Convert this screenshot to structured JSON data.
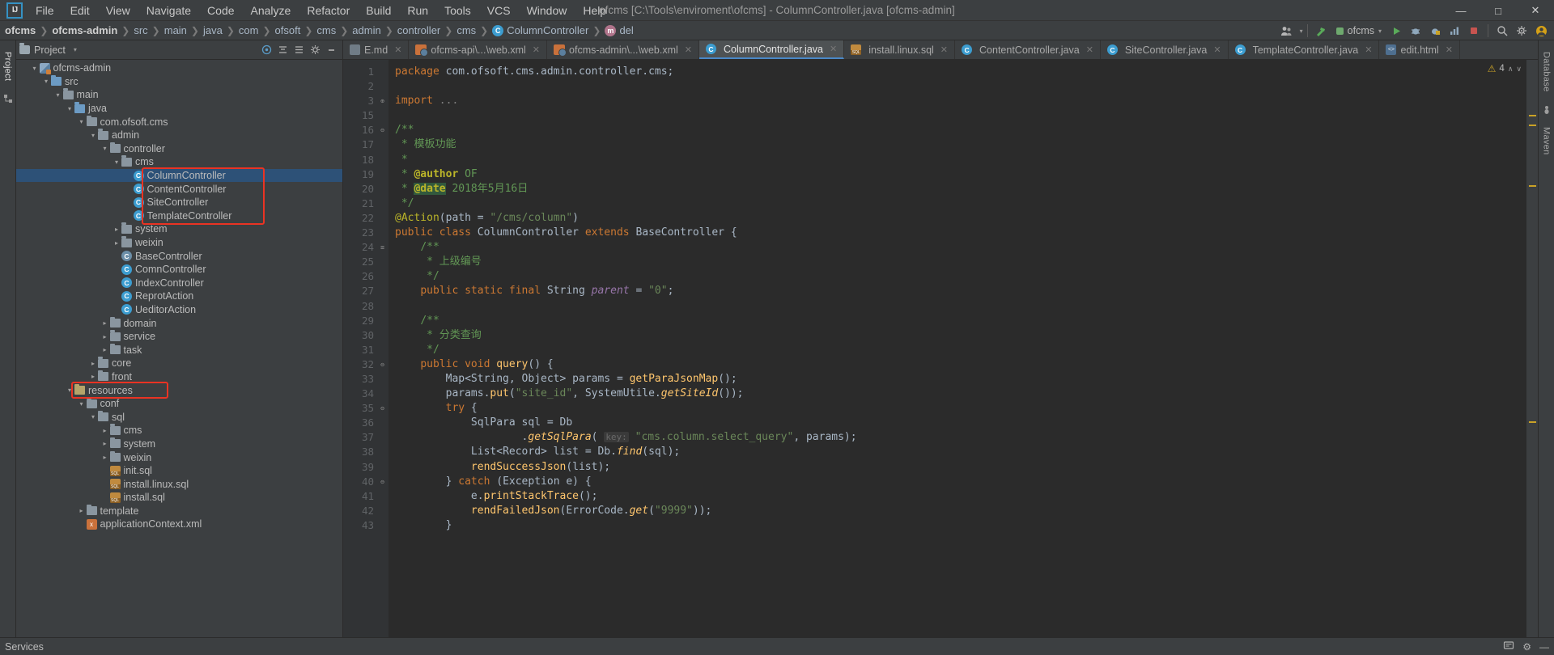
{
  "window": {
    "title": "ofcms [C:\\Tools\\enviroment\\ofcms] - ColumnController.java [ofcms-admin]",
    "logo": "IJ",
    "minimize": "—",
    "maximize": "□",
    "close": "✕"
  },
  "menu": [
    {
      "label": "File"
    },
    {
      "label": "Edit"
    },
    {
      "label": "View"
    },
    {
      "label": "Navigate"
    },
    {
      "label": "Code"
    },
    {
      "label": "Analyze"
    },
    {
      "label": "Refactor"
    },
    {
      "label": "Build"
    },
    {
      "label": "Run"
    },
    {
      "label": "Tools"
    },
    {
      "label": "VCS"
    },
    {
      "label": "Window"
    },
    {
      "label": "Help"
    }
  ],
  "breadcrumb": [
    {
      "label": "ofcms",
      "bold": true
    },
    {
      "label": "ofcms-admin",
      "bold": true
    },
    {
      "label": "src"
    },
    {
      "label": "main"
    },
    {
      "label": "java"
    },
    {
      "label": "com"
    },
    {
      "label": "ofsoft"
    },
    {
      "label": "cms"
    },
    {
      "label": "admin"
    },
    {
      "label": "controller"
    },
    {
      "label": "cms"
    },
    {
      "label": "ColumnController",
      "badge": "C"
    },
    {
      "label": "del",
      "badge": "m"
    }
  ],
  "navbar_right": {
    "run_config": "ofcms",
    "user_icon": "user-icon",
    "build_icon": "hammer-icon",
    "run_icon": "▶",
    "debug_icon": "debug-icon",
    "coverage_icon": "coverage-icon",
    "profile_icon": "profile-icon",
    "stop_icon": "■",
    "search_icon": "⚲",
    "settings_icon": "⚙",
    "avatar_icon": "avatar-icon"
  },
  "left_strip": {
    "project_tab": "Project",
    "structure_icon": "structure-icon"
  },
  "right_strip": {
    "database_tab": "Database",
    "maven_tab": "Maven",
    "ant_icon": "ant-icon"
  },
  "project_panel": {
    "title": "Project",
    "caret": "▾",
    "buttons": [
      "target-icon",
      "collapse-icon",
      "expand-icon",
      "gear-icon",
      "minimize-icon"
    ]
  },
  "tree": [
    {
      "indent": 1,
      "arrow": "▾",
      "icon": "module",
      "label": "ofcms-admin"
    },
    {
      "indent": 2,
      "arrow": "▾",
      "icon": "src",
      "label": "src"
    },
    {
      "indent": 3,
      "arrow": "▾",
      "icon": "folder",
      "label": "main"
    },
    {
      "indent": 4,
      "arrow": "▾",
      "icon": "src",
      "label": "java"
    },
    {
      "indent": 5,
      "arrow": "▾",
      "icon": "folder",
      "label": "com.ofsoft.cms"
    },
    {
      "indent": 6,
      "arrow": "▾",
      "icon": "folder",
      "label": "admin"
    },
    {
      "indent": 7,
      "arrow": "▾",
      "icon": "folder",
      "label": "controller"
    },
    {
      "indent": 8,
      "arrow": "▾",
      "icon": "folder",
      "label": "cms"
    },
    {
      "indent": 9,
      "arrow": "",
      "icon": "class",
      "label": "ColumnController",
      "selected": true
    },
    {
      "indent": 9,
      "arrow": "",
      "icon": "class",
      "label": "ContentController"
    },
    {
      "indent": 9,
      "arrow": "",
      "icon": "class",
      "label": "SiteController"
    },
    {
      "indent": 9,
      "arrow": "",
      "icon": "class",
      "label": "TemplateController"
    },
    {
      "indent": 8,
      "arrow": "▸",
      "icon": "folder",
      "label": "system"
    },
    {
      "indent": 8,
      "arrow": "▸",
      "icon": "folder",
      "label": "weixin"
    },
    {
      "indent": 8,
      "arrow": "",
      "icon": "class-abstract",
      "label": "BaseController"
    },
    {
      "indent": 8,
      "arrow": "",
      "icon": "class",
      "label": "ComnController"
    },
    {
      "indent": 8,
      "arrow": "",
      "icon": "class",
      "label": "IndexController"
    },
    {
      "indent": 8,
      "arrow": "",
      "icon": "class",
      "label": "ReprotAction"
    },
    {
      "indent": 8,
      "arrow": "",
      "icon": "class",
      "label": "UeditorAction"
    },
    {
      "indent": 7,
      "arrow": "▸",
      "icon": "folder",
      "label": "domain"
    },
    {
      "indent": 7,
      "arrow": "▸",
      "icon": "folder",
      "label": "service"
    },
    {
      "indent": 7,
      "arrow": "▸",
      "icon": "folder",
      "label": "task"
    },
    {
      "indent": 6,
      "arrow": "▸",
      "icon": "folder",
      "label": "core"
    },
    {
      "indent": 6,
      "arrow": "▸",
      "icon": "folder",
      "label": "front"
    },
    {
      "indent": 4,
      "arrow": "▾",
      "icon": "res",
      "label": "resources"
    },
    {
      "indent": 5,
      "arrow": "▾",
      "icon": "folder",
      "label": "conf"
    },
    {
      "indent": 6,
      "arrow": "▾",
      "icon": "folder",
      "label": "sql"
    },
    {
      "indent": 7,
      "arrow": "▸",
      "icon": "folder",
      "label": "cms"
    },
    {
      "indent": 7,
      "arrow": "▸",
      "icon": "folder",
      "label": "system"
    },
    {
      "indent": 7,
      "arrow": "▸",
      "icon": "folder",
      "label": "weixin"
    },
    {
      "indent": 7,
      "arrow": "",
      "icon": "sql",
      "label": "init.sql"
    },
    {
      "indent": 7,
      "arrow": "",
      "icon": "sql",
      "label": "install.linux.sql"
    },
    {
      "indent": 7,
      "arrow": "",
      "icon": "sql",
      "label": "install.sql"
    },
    {
      "indent": 5,
      "arrow": "▸",
      "icon": "folder",
      "label": "template"
    },
    {
      "indent": 5,
      "arrow": "",
      "icon": "xml",
      "label": "applicationContext.xml"
    }
  ],
  "editor_tabs": [
    {
      "label": "E.md",
      "icon": "md",
      "active": false
    },
    {
      "label": "ofcms-api\\...\\web.xml",
      "icon": "web",
      "active": false
    },
    {
      "label": "ofcms-admin\\...\\web.xml",
      "icon": "web",
      "active": false
    },
    {
      "label": "ColumnController.java",
      "icon": "class",
      "active": true
    },
    {
      "label": "install.linux.sql",
      "icon": "sql",
      "active": false
    },
    {
      "label": "ContentController.java",
      "icon": "class",
      "active": false
    },
    {
      "label": "SiteController.java",
      "icon": "class",
      "active": false
    },
    {
      "label": "TemplateController.java",
      "icon": "class",
      "active": false
    },
    {
      "label": "edit.html",
      "icon": "html",
      "active": false
    }
  ],
  "inspection": {
    "warning_count": "4",
    "warning_icon": "⚠",
    "up_arrow": "∧",
    "down_arrow": "∨"
  },
  "gutter_lines": [
    "1",
    "2",
    "3",
    "15",
    "16",
    "17",
    "18",
    "19",
    "20",
    "21",
    "22",
    "23",
    "24",
    "25",
    "26",
    "27",
    "28",
    "29",
    "30",
    "31",
    "32",
    "33",
    "34",
    "35",
    "36",
    "37",
    "38",
    "39",
    "40",
    "41",
    "42",
    "43"
  ],
  "code_lines": [
    {
      "n": "1",
      "fold": "",
      "html": "<span class=\"kw\">package</span> com.ofsoft.cms.admin.controller.cms;"
    },
    {
      "n": "2",
      "fold": "",
      "html": ""
    },
    {
      "n": "3",
      "fold": "⊕",
      "html": "<span class=\"kw\">import</span> <span class=\"cmt\">...</span>"
    },
    {
      "n": "15",
      "fold": "",
      "html": ""
    },
    {
      "n": "16",
      "fold": "⊖",
      "html": "<span class=\"doc\">/**</span>"
    },
    {
      "n": "17",
      "fold": "",
      "html": " <span class=\"doc\">* 模板功能</span>"
    },
    {
      "n": "18",
      "fold": "",
      "html": " <span class=\"doc\">*</span>"
    },
    {
      "n": "19",
      "fold": "",
      "html": " <span class=\"doc\">* </span><span class=\"tag\">@author</span><span class=\"doc\"> OF</span>"
    },
    {
      "n": "20",
      "fold": "",
      "html": " <span class=\"doc\">* </span><span class=\"tag\" style=\"background:#32593d\">@date</span><span class=\"doc\"> 2018年5月16日</span>"
    },
    {
      "n": "21",
      "fold": "",
      "html": " <span class=\"doc\">*/</span>"
    },
    {
      "n": "22",
      "fold": "",
      "html": "<span class=\"anno\">@Action</span>(path = <span class=\"str\">\"/cms/column\"</span>)"
    },
    {
      "n": "23",
      "fold": "",
      "html": "<span class=\"kw\">public class</span> <span class=\"cls\">ColumnController</span> <span class=\"kw\">extends</span> <span class=\"cls\">BaseController</span> {"
    },
    {
      "n": "24",
      "fold": "≡",
      "html": "    <span class=\"doc\">/**</span>"
    },
    {
      "n": "25",
      "fold": "",
      "html": "     <span class=\"doc\">* 上级编号</span>"
    },
    {
      "n": "26",
      "fold": "",
      "html": "     <span class=\"doc\">*/</span>"
    },
    {
      "n": "27",
      "fold": "",
      "html": "    <span class=\"kw\">public static final</span> <span class=\"cls\">String</span> <span class=\"fld\">parent</span> = <span class=\"str\">\"0\"</span>;"
    },
    {
      "n": "28",
      "fold": "",
      "html": ""
    },
    {
      "n": "29",
      "fold": "",
      "html": "    <span class=\"doc\">/**</span>"
    },
    {
      "n": "30",
      "fold": "",
      "html": "     <span class=\"doc\">* 分类查询</span>"
    },
    {
      "n": "31",
      "fold": "",
      "html": "     <span class=\"doc\">*/</span>"
    },
    {
      "n": "32",
      "fold": "⊖",
      "html": "    <span class=\"kw\">public void</span> <span class=\"mth\">query</span>() {"
    },
    {
      "n": "33",
      "fold": "",
      "html": "        Map&lt;<span class=\"cls\">String</span>, <span class=\"cls\">Object</span>&gt; params = <span class=\"mth\">getParaJsonMap</span>();"
    },
    {
      "n": "34",
      "fold": "",
      "html": "        params.<span class=\"mth\">put</span>(<span class=\"str\">\"site_id\"</span>, <span class=\"cls\">SystemUtile</span>.<span class=\"mth\" style=\"font-style:italic\">getSiteId</span>());"
    },
    {
      "n": "35",
      "fold": "⊖",
      "html": "        <span class=\"kw\">try</span> {"
    },
    {
      "n": "36",
      "fold": "",
      "html": "            <span class=\"cls\">SqlPara</span> sql = <span class=\"cls\">Db</span>"
    },
    {
      "n": "37",
      "fold": "",
      "html": "                    .<span class=\"mth\" style=\"font-style:italic\">getSqlPara</span>( <span class=\"hint\">key:</span> <span class=\"str\">\"cms.column.select_query\"</span>, params);"
    },
    {
      "n": "38",
      "fold": "",
      "html": "            List&lt;<span class=\"cls\">Record</span>&gt; list = <span class=\"cls\">Db</span>.<span class=\"mth\" style=\"font-style:italic\">find</span>(sql);"
    },
    {
      "n": "39",
      "fold": "",
      "html": "            <span class=\"mth\">rendSuccessJson</span>(list);"
    },
    {
      "n": "40",
      "fold": "⊖",
      "html": "        } <span class=\"kw\">catch</span> (<span class=\"cls\">Exception</span> e) {"
    },
    {
      "n": "41",
      "fold": "",
      "html": "            e.<span class=\"mth\">printStackTrace</span>();"
    },
    {
      "n": "42",
      "fold": "",
      "html": "            <span class=\"mth\">rendFailedJson</span>(<span class=\"cls\">ErrorCode</span>.<span class=\"mth\" style=\"font-style:italic\">get</span>(<span class=\"str\">\"9999\"</span>));"
    },
    {
      "n": "43",
      "fold": "",
      "html": "        }"
    }
  ],
  "statusbar": {
    "services": "Services",
    "event_icon": "event-icon",
    "gear_icon": "⚙",
    "hide_icon": "—"
  },
  "annotations": {
    "box1": "controller-classes-highlight",
    "box2": "resources-folder-highlight",
    "color": "#ea3323"
  },
  "colors": {
    "accent": "#4a88c7",
    "selection": "#2d5177",
    "editor_bg": "#2b2b2b",
    "panel_bg": "#3c3f41",
    "annotation": "#ea3323"
  }
}
